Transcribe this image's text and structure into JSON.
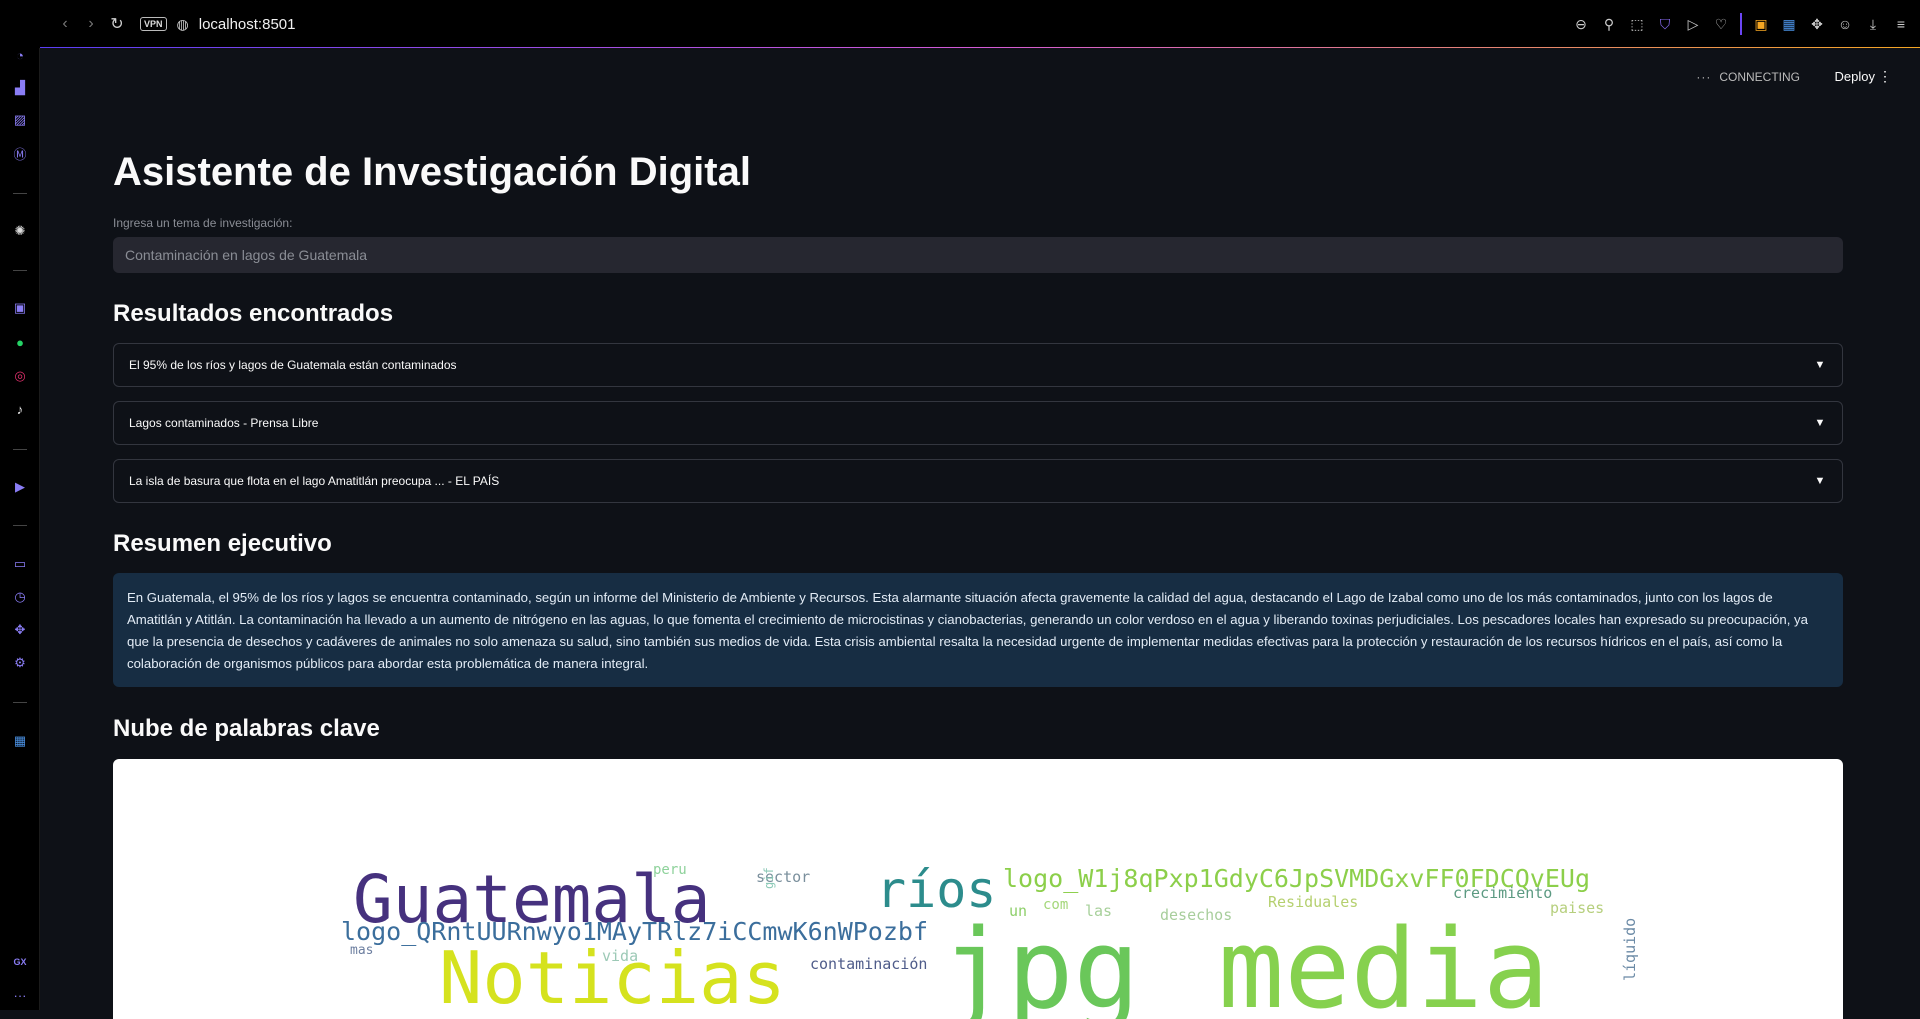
{
  "browser": {
    "vpn_label": "VPN",
    "url": "localhost:8501"
  },
  "streamlit": {
    "status": "CONNECTING",
    "deploy_label": "Deploy"
  },
  "page": {
    "title": "Asistente de Investigación Digital",
    "input_label": "Ingresa un tema de investigación:",
    "input_value": "Contaminación en lagos de Guatemala",
    "results_heading": "Resultados encontrados",
    "results": [
      {
        "label": "El 95% de los ríos y lagos de Guatemala están contaminados"
      },
      {
        "label": "Lagos contaminados - Prensa Libre"
      },
      {
        "label": "La isla de basura que flota en el lago Amatitlán preocupa ... - EL PAÍS"
      }
    ],
    "summary_heading": "Resumen ejecutivo",
    "summary_text": "En Guatemala, el 95% de los ríos y lagos se encuentra contaminado, según un informe del Ministerio de Ambiente y Recursos. Esta alarmante situación afecta gravemente la calidad del agua, destacando el Lago de Izabal como uno de los más contaminados, junto con los lagos de Amatitlán y Atitlán. La contaminación ha llevado a un aumento de nitrógeno en las aguas, lo que fomenta el crecimiento de microcistinas y cianobacterias, generando un color verdoso en el agua y liberando toxinas perjudiciales. Los pescadores locales han expresado su preocupación, ya que la presencia de desechos y cadáveres de animales no solo amenaza su salud, sino también sus medios de vida. Esta crisis ambiental resalta la necesidad urgente de implementar medidas efectivas para la protección y restauración de los recursos hídricos en el país, así como la colaboración de organismos públicos para abordar esta problemática de manera integral.",
    "wordcloud_heading": "Nube de palabras clave"
  },
  "wordcloud": {
    "words": [
      {
        "text": "Guatemala",
        "color": "#46317e"
      },
      {
        "text": "ríos",
        "color": "#2c8c8c"
      },
      {
        "text": "logo_W1j8qPxp1GdyC6JpSVMDGxvFF0FDCQvEUg",
        "color": "#8ccf4a"
      },
      {
        "text": "logo_QRntUURnwyo1MAyTRlz7iCCmwK6nWPozbf",
        "color": "#3b6e9c"
      },
      {
        "text": "jpg",
        "color": "#6ac75a"
      },
      {
        "text": "media",
        "color": "#86d14e"
      },
      {
        "text": "Noticias",
        "color": "#d5e21e"
      },
      {
        "text": "peru",
        "color": "#8ed29b"
      },
      {
        "text": "sector",
        "color": "#7a8f9c"
      },
      {
        "text": "gif",
        "color": "#8cc9b7"
      },
      {
        "text": "mas",
        "color": "#6d7fa0"
      },
      {
        "text": "vida",
        "color": "#9cc9b6"
      },
      {
        "text": "un",
        "color": "#8ecf6a"
      },
      {
        "text": "com",
        "color": "#a4d77a"
      },
      {
        "text": "las",
        "color": "#a7d09a"
      },
      {
        "text": "desechos",
        "color": "#a8ce9c"
      },
      {
        "text": "Residuales",
        "color": "#b5d06f"
      },
      {
        "text": "crecimiento",
        "color": "#5c9a82"
      },
      {
        "text": "paises",
        "color": "#b6cf7d"
      },
      {
        "text": "contaminación",
        "color": "#4f5c8a"
      },
      {
        "text": "líquido",
        "color": "#6b8aa6"
      }
    ]
  }
}
